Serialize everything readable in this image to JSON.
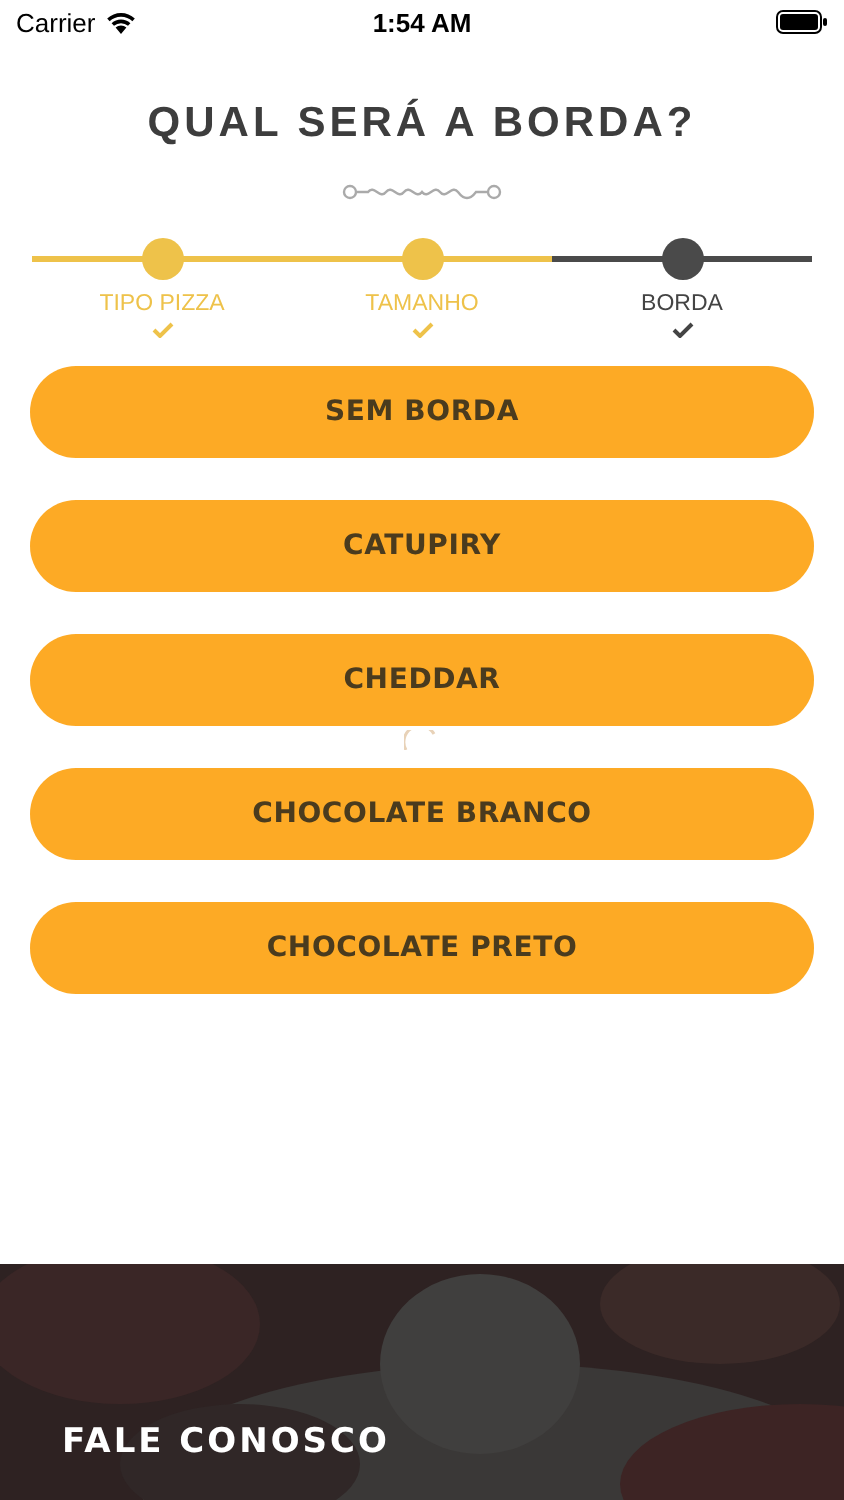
{
  "status_bar": {
    "carrier": "Carrier",
    "time": "1:54 AM"
  },
  "title": "QUAL SERÁ A BORDA?",
  "steps": [
    {
      "label": "TIPO PIZZA",
      "selected": false
    },
    {
      "label": "TAMANHO",
      "selected": false
    },
    {
      "label": "BORDA",
      "selected": true
    }
  ],
  "options": [
    "SEM BORDA",
    "CATUPIRY",
    "CHEDDAR",
    "CHOCOLATE BRANCO",
    "CHOCOLATE PRETO"
  ],
  "loading": true,
  "footer": {
    "label": "FALE CONOSCO"
  }
}
